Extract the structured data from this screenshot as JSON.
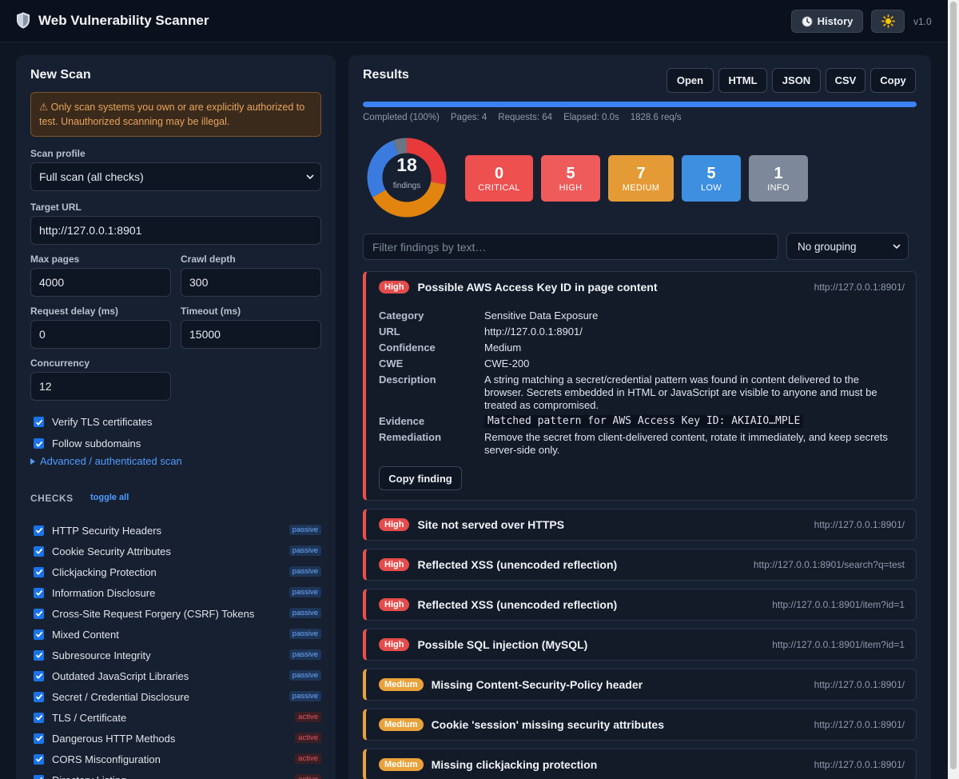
{
  "app": {
    "title": "Web Vulnerability Scanner",
    "history_label": "History",
    "version": "v1.0",
    "logo_icon": "shield-icon",
    "theme_icon": "sun-icon"
  },
  "scan": {
    "title": "New Scan",
    "warning": "⚠ Only scan systems you own or are explicitly authorized to test. Unauthorized scanning may be illegal.",
    "profile_label": "Scan profile",
    "profile_value": "Full scan (all checks)",
    "target_label": "Target URL",
    "target_value": "http://127.0.0.1:8901",
    "max_pages_label": "Max pages",
    "max_pages_value": "4000",
    "crawl_depth_label": "Crawl depth",
    "crawl_depth_value": "300",
    "delay_label": "Request delay (ms)",
    "delay_value": "0",
    "timeout_label": "Timeout (ms)",
    "timeout_value": "15000",
    "concurrency_label": "Concurrency",
    "concurrency_value": "12",
    "verify_tls_label": "Verify TLS certificates",
    "verify_tls_checked": true,
    "follow_sub_label": "Follow subdomains",
    "follow_sub_checked": true,
    "advanced_label": "Advanced / authenticated scan",
    "checks_heading": "CHECKS",
    "toggle_all_label": "toggle all",
    "checks": [
      {
        "label": "HTTP Security Headers",
        "tag": "passive",
        "checked": true
      },
      {
        "label": "Cookie Security Attributes",
        "tag": "passive",
        "checked": true
      },
      {
        "label": "Clickjacking Protection",
        "tag": "passive",
        "checked": true
      },
      {
        "label": "Information Disclosure",
        "tag": "passive",
        "checked": true
      },
      {
        "label": "Cross-Site Request Forgery (CSRF) Tokens",
        "tag": "passive",
        "checked": true
      },
      {
        "label": "Mixed Content",
        "tag": "passive",
        "checked": true
      },
      {
        "label": "Subresource Integrity",
        "tag": "passive",
        "checked": true
      },
      {
        "label": "Outdated JavaScript Libraries",
        "tag": "passive",
        "checked": true
      },
      {
        "label": "Secret / Credential Disclosure",
        "tag": "passive",
        "checked": true
      },
      {
        "label": "TLS / Certificate",
        "tag": "active",
        "checked": true
      },
      {
        "label": "Dangerous HTTP Methods",
        "tag": "active",
        "checked": true
      },
      {
        "label": "CORS Misconfiguration",
        "tag": "active",
        "checked": true
      },
      {
        "label": "Directory Listing",
        "tag": "active",
        "checked": true
      }
    ]
  },
  "results": {
    "title": "Results",
    "actions": [
      "Open",
      "HTML",
      "JSON",
      "CSV",
      "Copy"
    ],
    "progress": 1.0,
    "stats": {
      "status": "Completed (100%)",
      "pages": "Pages: 4",
      "requests": "Requests: 64",
      "elapsed": "Elapsed: 0.0s",
      "rate": "1828.6 req/s"
    },
    "total": "18",
    "total_label": "findings",
    "severity": [
      {
        "key": "critical",
        "count": "0",
        "label": "CRITICAL",
        "color": "#ee4f4f"
      },
      {
        "key": "high",
        "count": "5",
        "label": "HIGH",
        "color": "#ef5b5b"
      },
      {
        "key": "medium",
        "count": "7",
        "label": "MEDIUM",
        "color": "#e49b35"
      },
      {
        "key": "low",
        "count": "5",
        "label": "LOW",
        "color": "#3d8fe0"
      },
      {
        "key": "info",
        "count": "1",
        "label": "INFO",
        "color": "#7d889a"
      }
    ],
    "donut": [
      {
        "key": "high",
        "value": 5,
        "color": "#e83a3a"
      },
      {
        "key": "medium",
        "value": 7,
        "color": "#e2850f"
      },
      {
        "key": "low",
        "value": 5,
        "color": "#3b7be0"
      },
      {
        "key": "info",
        "value": 1,
        "color": "#6b7585"
      }
    ],
    "filter_placeholder": "Filter findings by text…",
    "grouping_value": "No grouping",
    "expanded": {
      "severity": "High",
      "title": "Possible AWS Access Key ID in page content",
      "url": "http://127.0.0.1:8901/",
      "rows": [
        {
          "k": "Category",
          "v": "Sensitive Data Exposure"
        },
        {
          "k": "URL",
          "v": "http://127.0.0.1:8901/"
        },
        {
          "k": "Confidence",
          "v": "Medium"
        },
        {
          "k": "CWE",
          "v": "CWE-200"
        },
        {
          "k": "Description",
          "v": "A string matching a secret/credential pattern was found in content delivered to the browser. Secrets embedded in HTML or JavaScript are visible to anyone and must be treated as compromised."
        },
        {
          "k": "Evidence",
          "v": "Matched pattern for AWS Access Key ID: AKIAIO…MPLE"
        },
        {
          "k": "Remediation",
          "v": "Remove the secret from client-delivered content, rotate it immediately, and keep secrets server-side only."
        }
      ],
      "copy_label": "Copy finding"
    },
    "findings": [
      {
        "severity": "High",
        "title": "Site not served over HTTPS",
        "url": "http://127.0.0.1:8901/"
      },
      {
        "severity": "High",
        "title": "Reflected XSS (unencoded reflection)",
        "url": "http://127.0.0.1:8901/search?q=test"
      },
      {
        "severity": "High",
        "title": "Reflected XSS (unencoded reflection)",
        "url": "http://127.0.0.1:8901/item?id=1"
      },
      {
        "severity": "High",
        "title": "Possible SQL injection (MySQL)",
        "url": "http://127.0.0.1:8901/item?id=1"
      },
      {
        "severity": "Medium",
        "title": "Missing Content-Security-Policy header",
        "url": "http://127.0.0.1:8901/"
      },
      {
        "severity": "Medium",
        "title": "Cookie 'session' missing security attributes",
        "url": "http://127.0.0.1:8901/"
      },
      {
        "severity": "Medium",
        "title": "Missing clickjacking protection",
        "url": "http://127.0.0.1:8901/"
      }
    ]
  }
}
